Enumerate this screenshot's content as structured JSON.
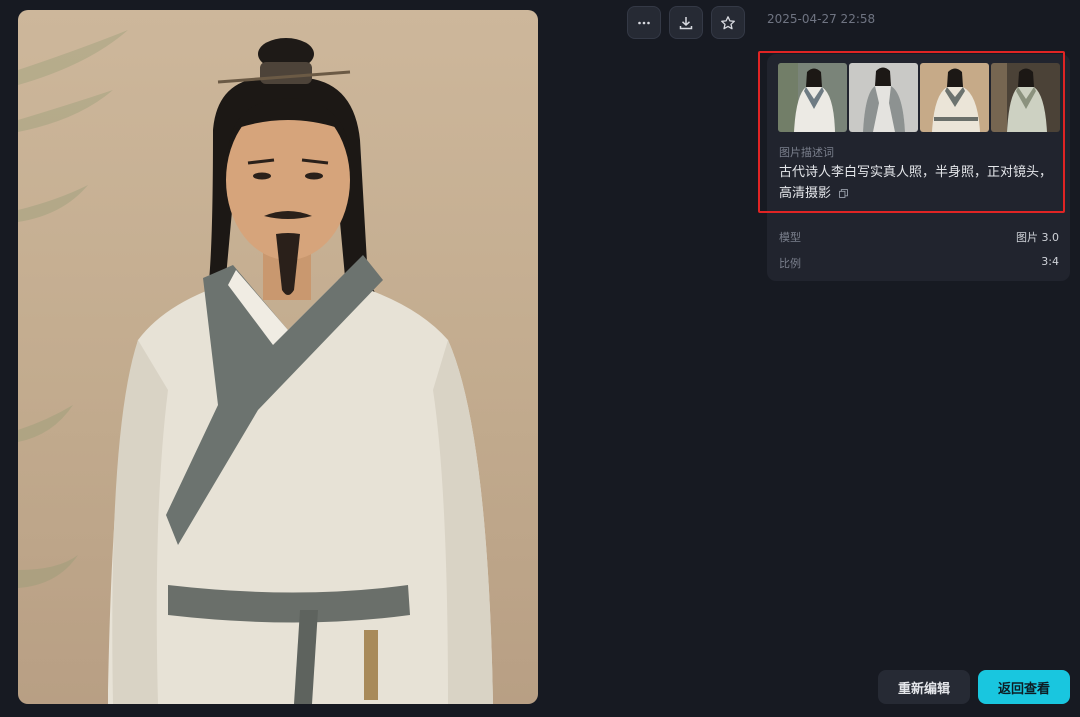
{
  "timestamp": "2025-04-27 22:58",
  "toolbar": {
    "more_icon": "more-horizontal-icon",
    "download_icon": "download-icon",
    "favorite_icon": "star-icon"
  },
  "prompt": {
    "label": "图片描述词",
    "text": "古代诗人李白写实真人照，半身照，正对镜头，高清摄影"
  },
  "meta": {
    "model_label": "模型",
    "model_value": "图片 3.0",
    "ratio_label": "比例",
    "ratio_value": "3:4"
  },
  "buttons": {
    "reedit": "重新编辑",
    "back": "返回查看"
  },
  "colors": {
    "background": "#171a22",
    "card": "#21242e",
    "accent": "#19c6df",
    "highlight": "#e02424"
  }
}
